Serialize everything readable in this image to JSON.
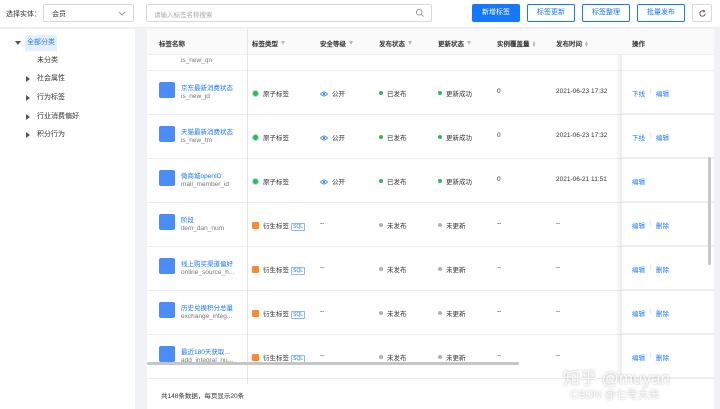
{
  "topbar": {
    "entity_label": "选择实体：",
    "entity_value": "会员",
    "search_placeholder": "请输入标签名称搜索",
    "buttons": {
      "new_tag": "新增标签",
      "update_tag": "标签更新",
      "organize_tag": "标签整理",
      "batch_publish": "批量发布"
    }
  },
  "sidebar": {
    "root": "全部分类",
    "items": [
      "未分类",
      "社会属性",
      "行为标签",
      "行业消费偏好",
      "积分行为"
    ]
  },
  "table": {
    "headers": {
      "name": "标签名称",
      "type": "标签类型",
      "security": "安全等级",
      "publish": "发布状态",
      "update": "更新状态",
      "coverage": "实例覆盖量",
      "publish_time": "发布时间",
      "actions": "操作"
    },
    "partial_top_code": "is_new_qn",
    "rows": [
      {
        "name": "京东最新消费状态",
        "code": "is_new_jd",
        "type": "原子标签",
        "sql": "",
        "security": "公开",
        "publish": "已发布",
        "update": "更新成功",
        "coverage": "0",
        "time": "2021-06-23 17:32",
        "action1": "下线",
        "action2": "编辑"
      },
      {
        "name": "天猫最新消费状态",
        "code": "is_new_tm",
        "type": "原子标签",
        "sql": "",
        "security": "公开",
        "publish": "已发布",
        "update": "更新成功",
        "coverage": "0",
        "time": "2021-06-23 17:32",
        "action1": "下线",
        "action2": "编辑"
      },
      {
        "name": "微商城openID",
        "code": "mall_member_id",
        "type": "原子标签",
        "sql": "",
        "security": "公开",
        "publish": "已发布",
        "update": "更新成功",
        "coverage": "0",
        "time": "2021-06-21 11:51",
        "action1": "编辑",
        "action2": ""
      },
      {
        "name": "阶段",
        "code": "item_dan_num",
        "type": "衍生标签",
        "sql": "SQL",
        "security": "--",
        "publish": "未发布",
        "update": "未更新",
        "coverage": "--",
        "time": "--",
        "action1": "编辑",
        "action2": "删除"
      },
      {
        "name": "线上购买渠道偏好",
        "code": "online_source_h...",
        "type": "衍生标签",
        "sql": "SQL",
        "security": "--",
        "publish": "未发布",
        "update": "未更新",
        "coverage": "--",
        "time": "--",
        "action1": "编辑",
        "action2": "删除"
      },
      {
        "name": "历史兑换积分总量",
        "code": "exchange_integ...",
        "type": "衍生标签",
        "sql": "SQL",
        "security": "--",
        "publish": "未发布",
        "update": "未更新",
        "coverage": "--",
        "time": "--",
        "action1": "编辑",
        "action2": "删除"
      },
      {
        "name": "最近180天获取...",
        "code": "add_integral_nu...",
        "type": "衍生标签",
        "sql": "SQL",
        "security": "--",
        "publish": "未发布",
        "update": "未更新",
        "coverage": "--",
        "time": "--",
        "action1": "编辑",
        "action2": "删除"
      }
    ]
  },
  "footer": {
    "text": "共148条数据，每页显示20条"
  },
  "watermarks": {
    "zhihu": "知乎 @muyan",
    "csdn": "CSDN @七号大米"
  },
  "colors": {
    "primary": "#1677ff",
    "published": "#31b65e",
    "unpublished": "#b0b0b0",
    "atom_tag": "#31b65e",
    "derived_tag": "#ff8a2b"
  }
}
